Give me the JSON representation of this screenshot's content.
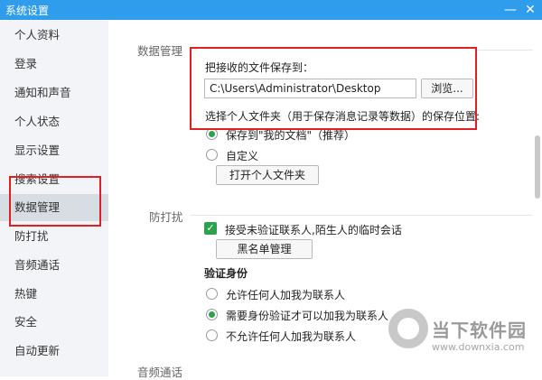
{
  "window": {
    "title": "系统设置",
    "min_icon": "minimize-icon",
    "close_icon": "close-icon"
  },
  "sidebar": {
    "items": [
      {
        "label": "个人资料"
      },
      {
        "label": "登录"
      },
      {
        "label": "通知和声音"
      },
      {
        "label": "个人状态"
      },
      {
        "label": "显示设置"
      },
      {
        "label": "搜索设置"
      },
      {
        "label": "数据管理"
      },
      {
        "label": "防打扰"
      },
      {
        "label": "音频通话"
      },
      {
        "label": "热键"
      },
      {
        "label": "安全"
      },
      {
        "label": "自动更新"
      }
    ]
  },
  "data_mgmt": {
    "section_title": "数据管理",
    "save_files_label": "把接收的文件保存到：",
    "save_path_value": "C:\\Users\\Administrator\\Desktop",
    "browse_label": "浏览...",
    "folder_hint": "选择个人文件夹（用于保存消息记录等数据）的保存位置:",
    "option_docs": "保存到\"我的文档\"（推荐）",
    "option_custom": "自定义",
    "open_folder_label": "打开个人文件夹"
  },
  "dnd": {
    "section_title": "防打扰",
    "accept_temp_label": "接受未验证联系人,陌生人的临时会话",
    "blacklist_label": "黑名单管理",
    "verify_title": "验证身份",
    "verify_options": [
      {
        "label": "允许任何人加我为联系人"
      },
      {
        "label": "需要身份验证才可以加我为联系人"
      },
      {
        "label": "不允许任何人加我为联系人"
      }
    ]
  },
  "audio": {
    "section_title": "音频通话"
  },
  "watermark": {
    "brand": "当下软件园",
    "url": "www.downxia.com"
  },
  "colors": {
    "titlebar": "#2f9cec",
    "accent_green": "#2ea14d",
    "highlight_red": "#e02020"
  }
}
